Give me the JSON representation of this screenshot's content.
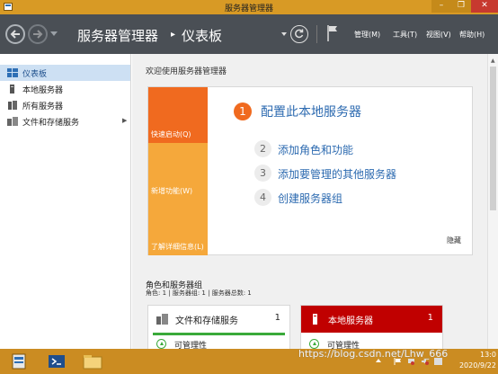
{
  "window": {
    "title": "服务器管理器",
    "controls": {
      "minimize": "–",
      "maximize": "❐",
      "close": "✕"
    }
  },
  "nav": {
    "breadcrumb_root": "服务器管理器",
    "breadcrumb_sep": "▸",
    "breadcrumb_current": "仪表板",
    "menus": [
      "管理(M)",
      "工具(T)",
      "视图(V)",
      "帮助(H)"
    ]
  },
  "sidebar": {
    "items": [
      {
        "label": "仪表板",
        "icon": "dashboard-icon",
        "active": true
      },
      {
        "label": "本地服务器",
        "icon": "server-icon"
      },
      {
        "label": "所有服务器",
        "icon": "servers-icon"
      },
      {
        "label": "文件和存储服务",
        "icon": "storage-icon",
        "expandable": true
      }
    ]
  },
  "main": {
    "welcome": "欢迎使用服务器管理器",
    "tiles": [
      "快速启动(Q)",
      "新增功能(W)",
      "了解详细信息(L)"
    ],
    "steps": [
      {
        "num": "1",
        "text": "配置此本地服务器"
      },
      {
        "num": "2",
        "text": "添加角色和功能"
      },
      {
        "num": "3",
        "text": "添加要管理的其他服务器"
      },
      {
        "num": "4",
        "text": "创建服务器组"
      }
    ],
    "hide": "隐藏",
    "roles_heading": "角色和服务器组",
    "roles_summary": "角色: 1 | 服务器组: 1 | 服务器总数: 1",
    "cards": [
      {
        "title": "文件和存储服务",
        "count": "1",
        "status": "可管理性",
        "header_color": "#ffffff"
      },
      {
        "title": "本地服务器",
        "count": "1",
        "status": "可管理性",
        "header_color": "#c00000"
      }
    ]
  },
  "taskbar": {
    "time": "13:0",
    "date": "2020/9/22"
  },
  "watermark": "https://blog.csdn.net/Lhw_666",
  "colors": {
    "accent": "#d89a25",
    "tile_primary": "#f06a1f",
    "tile_secondary": "#f5a83b",
    "link": "#2c6ab0",
    "alert": "#c00000",
    "ok": "#3aaa3a"
  }
}
